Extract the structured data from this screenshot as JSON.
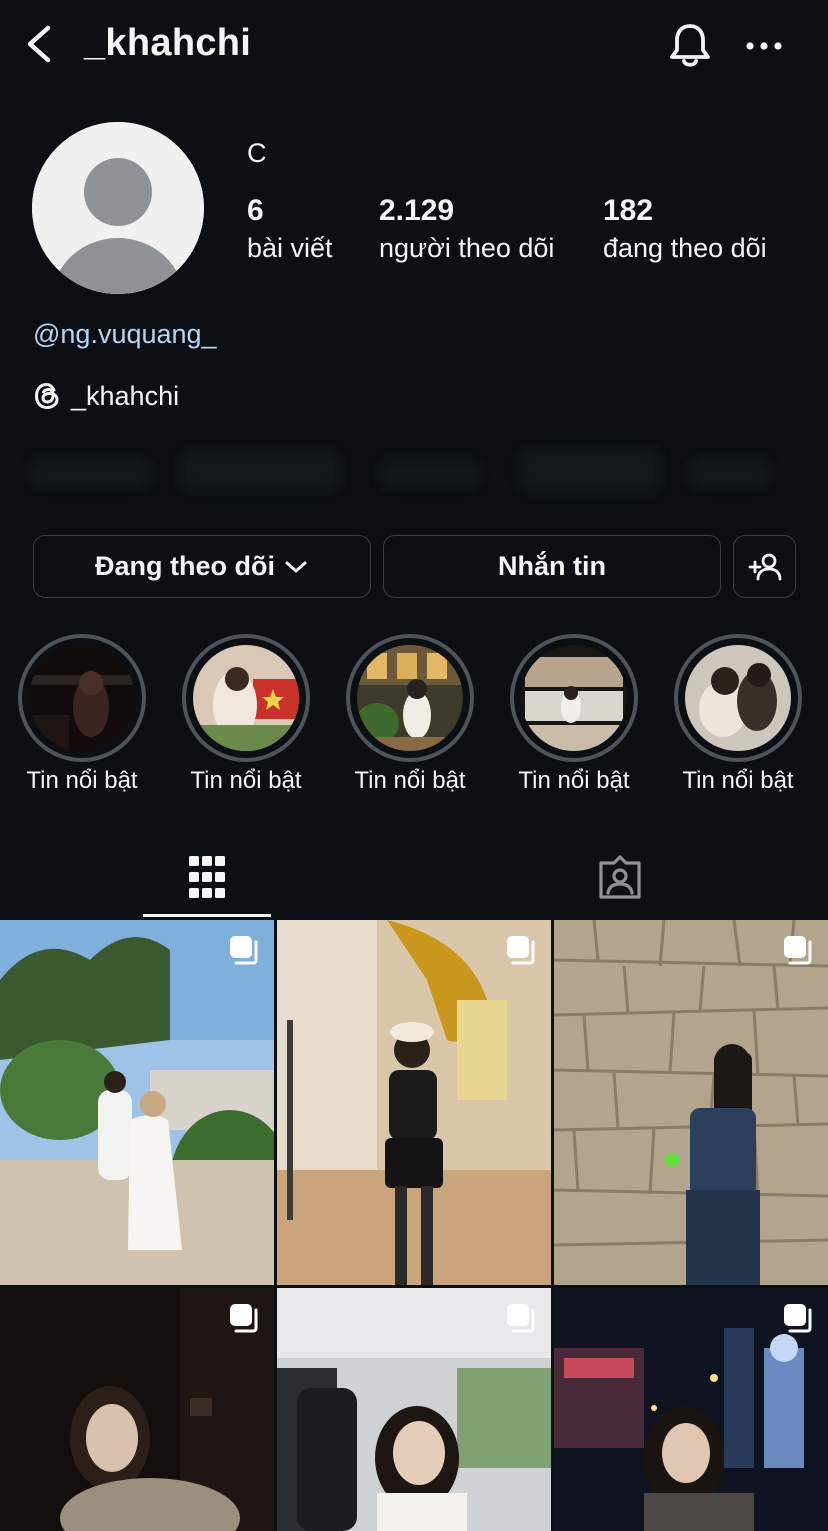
{
  "header": {
    "username": "_khahchi",
    "back_icon": "chevron-left-icon",
    "bell_icon": "bell-icon",
    "more_icon": "more-horizontal-icon"
  },
  "profile": {
    "display_name": "C",
    "stats": [
      {
        "value": "6",
        "label": "bài viết"
      },
      {
        "value": "2.129",
        "label": "người theo dõi"
      },
      {
        "value": "182",
        "label": "đang theo dõi"
      }
    ],
    "mention": "@ng.vuquang_",
    "threads_handle": "_khahchi",
    "link_color": "#b8d4f0"
  },
  "actions": {
    "following_label": "Đang theo dõi",
    "message_label": "Nhắn tin"
  },
  "highlights": [
    {
      "label": "Tin nổi bật"
    },
    {
      "label": "Tin nổi bật"
    },
    {
      "label": "Tin nổi bật"
    },
    {
      "label": "Tin nổi bật"
    },
    {
      "label": "Tin nổi bật"
    }
  ],
  "tabs": [
    {
      "icon": "grid-icon",
      "active": true
    },
    {
      "icon": "tagged-person-icon",
      "active": false
    }
  ],
  "posts": [
    {
      "description": "beach-couple-photo",
      "multi": true
    },
    {
      "description": "black-outfit-photo",
      "multi": true
    },
    {
      "description": "stone-wall-photo",
      "multi": true
    },
    {
      "description": "night-portrait-photo",
      "multi": true
    },
    {
      "description": "car-selfie-photo",
      "multi": true
    },
    {
      "description": "city-night-photo",
      "multi": true
    }
  ],
  "colors": {
    "background": "#0c1014",
    "text": "#f5f5f5",
    "border": "#3a3f46"
  }
}
